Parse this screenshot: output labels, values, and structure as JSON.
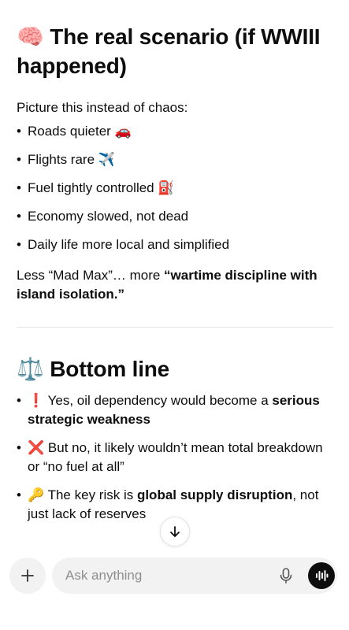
{
  "section1": {
    "icon": "brain-icon",
    "icon_glyph": "🧠",
    "title": "The real scenario (if WWIII happened)",
    "intro": "Picture this instead of chaos:",
    "items": [
      {
        "text": "Roads quieter",
        "icon": "car-icon",
        "glyph": "🚗"
      },
      {
        "text": "Flights rare",
        "icon": "airplane-icon",
        "glyph": "✈️"
      },
      {
        "text": "Fuel tightly controlled",
        "icon": "fuel-pump-icon",
        "glyph": "⛽"
      },
      {
        "text": "Economy slowed, not dead",
        "icon": "",
        "glyph": ""
      },
      {
        "text": "Daily life more local and simplified",
        "icon": "",
        "glyph": ""
      }
    ],
    "closing_plain": "Less “Mad Max”… more ",
    "closing_bold": "“wartime discipline with island isolation.”"
  },
  "section2": {
    "icon": "balance-scale-icon",
    "icon_glyph": "⚖️",
    "title": "Bottom line",
    "items": [
      {
        "icon": "exclamation-icon",
        "glyph": "❗",
        "before": "Yes, oil dependency would become a ",
        "bold": "serious strategic weakness",
        "after": ""
      },
      {
        "icon": "cross-mark-icon",
        "glyph": "❌",
        "before": "But no, it likely wouldn’t mean total breakdown or “no fuel at all”",
        "bold": "",
        "after": ""
      },
      {
        "icon": "key-icon",
        "glyph": "🔑",
        "before": "The key risk is ",
        "bold": "global supply disruption",
        "after": ", not just lack of reserves"
      }
    ]
  },
  "composer": {
    "placeholder": "Ask anything",
    "plus_icon": "plus-icon",
    "mic_icon": "microphone-icon",
    "voice_icon": "voice-mode-icon"
  },
  "scroll_down_icon": "arrow-down-icon",
  "bullet": "•"
}
